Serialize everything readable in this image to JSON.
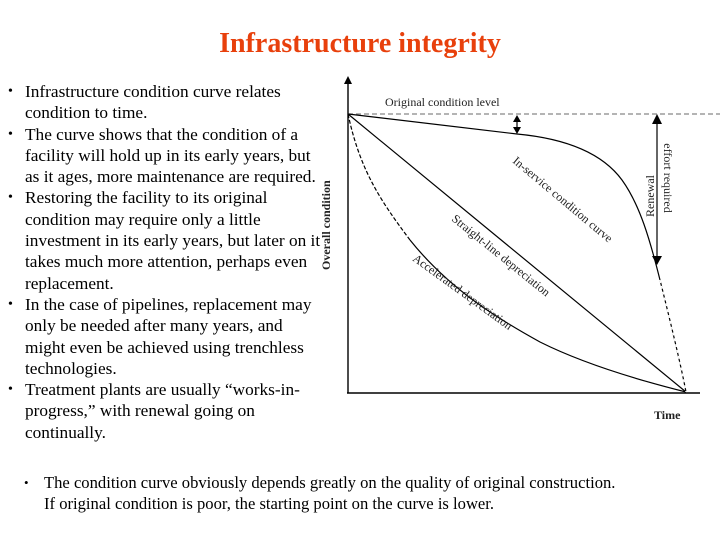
{
  "title": "Infrastructure integrity",
  "bullets": [
    {
      "lines": [
        "Infrastructure condition curve relates",
        "condition to time."
      ]
    },
    {
      "lines": [
        "The curve shows that the condition of a",
        "facility will hold up in its early years, but",
        "as it ages, more maintenance are required."
      ]
    },
    {
      "lines": [
        "Restoring the facility to its original",
        "condition may require only a little",
        "investment in its early years, but later on it",
        "takes much more attention, perhaps even",
        "replacement."
      ]
    },
    {
      "lines": [
        "In the case of pipelines, replacement may",
        "only be needed after many years, and",
        "might even be achieved using trenchless",
        "technologies."
      ]
    },
    {
      "lines": [
        "Treatment plants are usually “works-in-",
        "progress,” with renewal going on",
        "continually."
      ]
    }
  ],
  "bullet_symbol": "•",
  "footer": {
    "lines": [
      "The condition curve obviously depends greatly on the quality of original construction.",
      "If original condition is poor, the starting point on the curve is lower."
    ]
  },
  "diagram": {
    "y_axis_label": "Overall condition",
    "x_axis_label": "Time",
    "original_level_label": "Original condition level",
    "curves": {
      "in_service": "In-service condition curve",
      "straight_line": "Straight-line depreciation",
      "accelerated": "Accelerated depreciation"
    },
    "renewal_label_line1": "Renewal",
    "renewal_label_line2": "effort required"
  },
  "colors": {
    "title": "#e8400c",
    "text": "#000000",
    "dashed_line": "#888888"
  }
}
